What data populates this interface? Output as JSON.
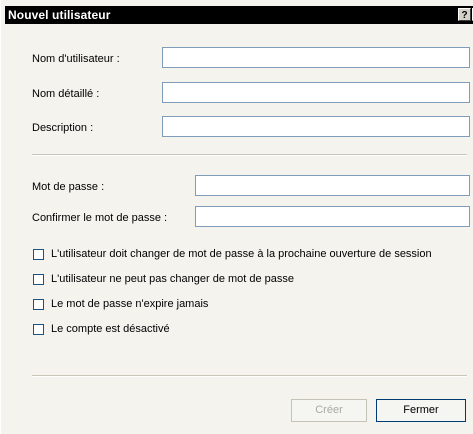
{
  "window": {
    "title": "Nouvel utilisateur",
    "help_button": "?",
    "close_button": "✕"
  },
  "fields": {
    "username_label": "Nom d'utilisateur :",
    "username_value": "",
    "fullname_label": "Nom détaillé :",
    "fullname_value": "",
    "description_label": "Description :",
    "description_value": "",
    "password_label": "Mot de passe :",
    "password_value": "",
    "confirm_label": "Confirmer le mot de passe :",
    "confirm_value": ""
  },
  "options": [
    {
      "label": "L'utilisateur doit changer de mot de passe à la prochaine ouverture de session",
      "checked": false
    },
    {
      "label": "L'utilisateur ne peut pas changer de mot de passe",
      "checked": false
    },
    {
      "label": "Le mot de passe n'expire jamais",
      "checked": false
    },
    {
      "label": "Le compte est désactivé",
      "checked": false
    }
  ],
  "buttons": {
    "create": "Créer",
    "close": "Fermer"
  }
}
